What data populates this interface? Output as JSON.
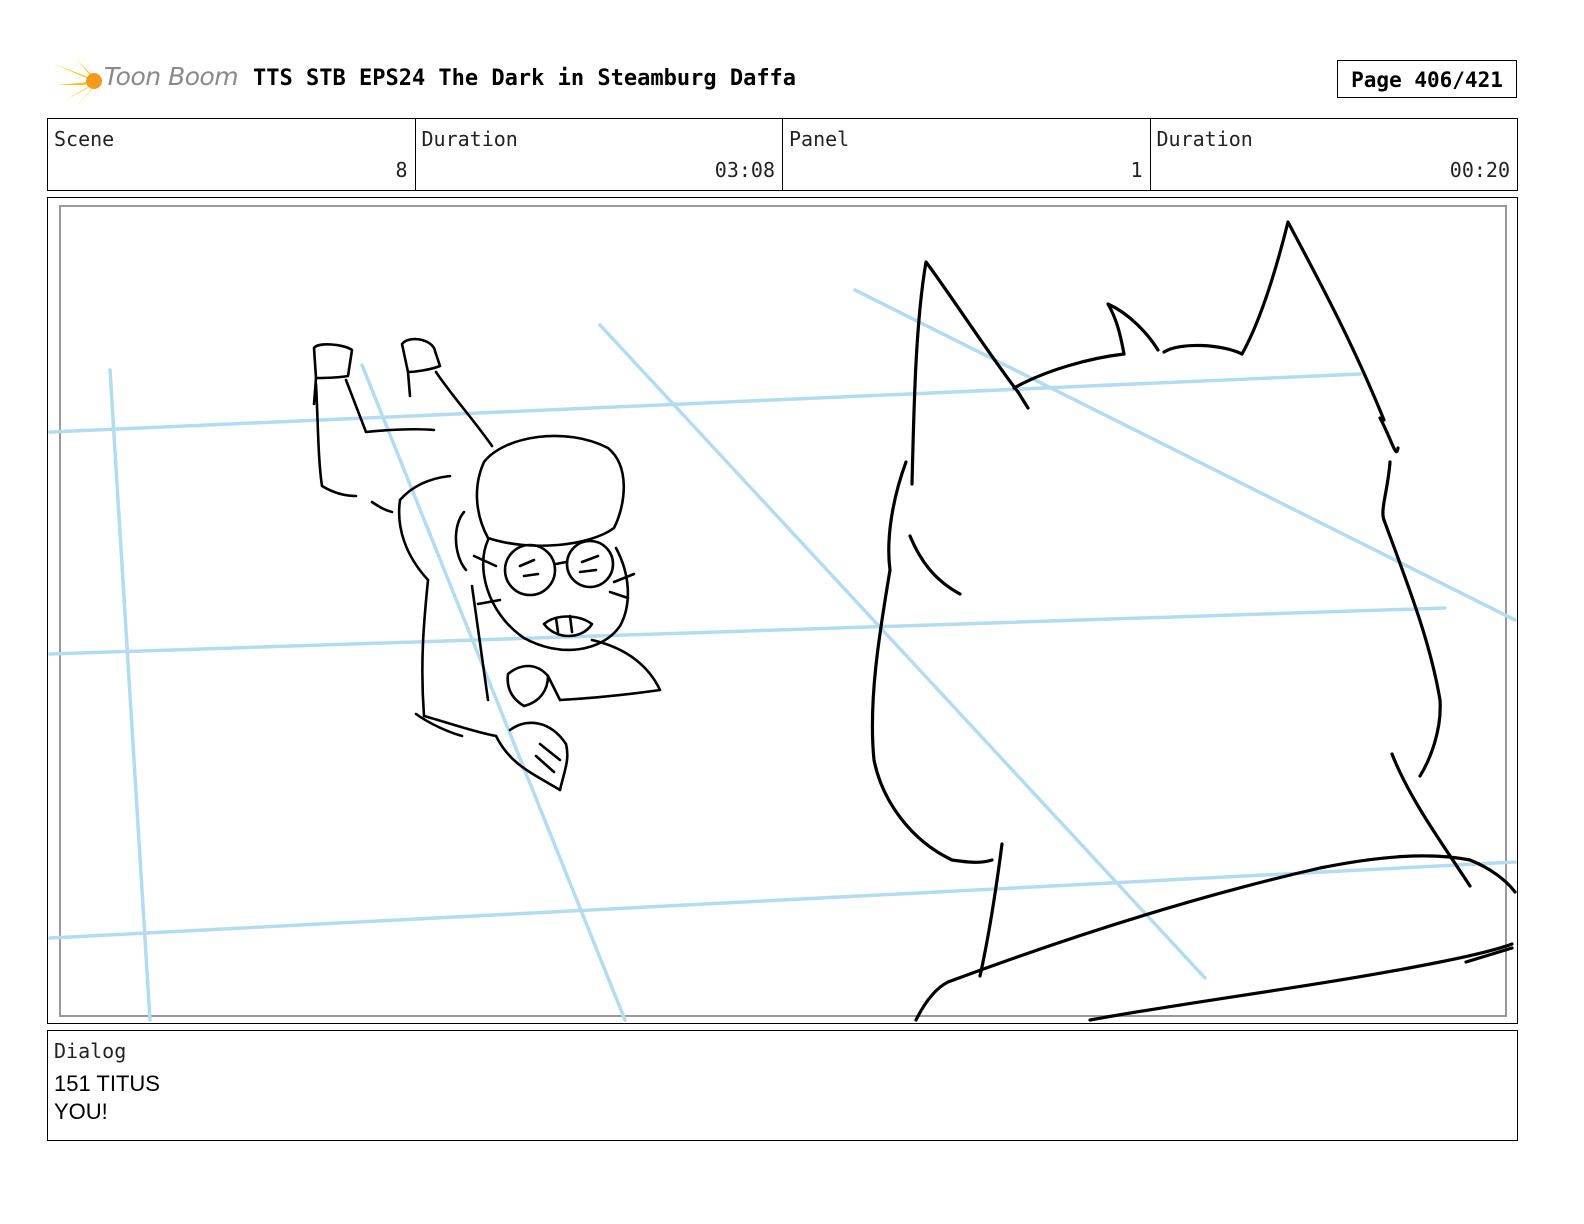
{
  "header": {
    "logo_text": "Toon Boom",
    "title": "TTS STB EPS24 The Dark in Steamburg Daffa",
    "page": "Page 406/421"
  },
  "info": {
    "scene_label": "Scene",
    "scene_value": "8",
    "scene_duration_label": "Duration",
    "scene_duration_value": "03:08",
    "panel_label": "Panel",
    "panel_value": "1",
    "panel_duration_label": "Duration",
    "panel_duration_value": "00:20"
  },
  "dialog": {
    "label": "Dialog",
    "lines": [
      "151 TITUS",
      "YOU!"
    ]
  },
  "colors": {
    "guide_blue": "#b3dcf2",
    "logo_yellow": "#f6c21c",
    "logo_orange": "#f29a1d"
  }
}
